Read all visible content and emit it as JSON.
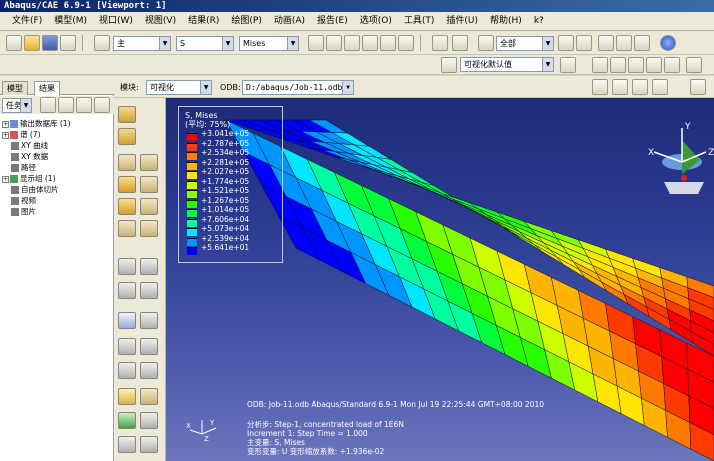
{
  "window": {
    "title": "Abaqus/CAE 6.9-1 [Viewport: 1]"
  },
  "menu": [
    "文件(F)",
    "模型(M)",
    "视口(W)",
    "视图(V)",
    "结果(R)",
    "绘图(P)",
    "动画(A)",
    "报告(E)",
    "选项(O)",
    "工具(T)",
    "插件(U)",
    "帮助(H)",
    "k?"
  ],
  "toolbar1": {
    "combo1": "主",
    "combo2": "S",
    "combo3": "Mises",
    "combo4": "全部"
  },
  "toolbar2": {
    "render_combo": "可视化默认值"
  },
  "toolbar3": {
    "module_label": "模块:",
    "module_value": "可视化",
    "odb_label": "ODB:",
    "odb_value": "D:/abaqus/Job-11.odb"
  },
  "left_panel": {
    "tabs": [
      "模型",
      "结果"
    ],
    "task_label": "任务",
    "tree": [
      {
        "label": "输出数据库 (1)",
        "expand": "+"
      },
      {
        "label": "谱 (7)",
        "expand": "+"
      },
      {
        "label": "XY 曲线",
        "expand": ""
      },
      {
        "label": "XY 数据",
        "expand": ""
      },
      {
        "label": "路径",
        "expand": ""
      },
      {
        "label": "显示组 (1)",
        "expand": "+"
      },
      {
        "label": "自由体切片",
        "expand": ""
      },
      {
        "label": "视频",
        "expand": ""
      },
      {
        "label": "图片",
        "expand": ""
      }
    ]
  },
  "legend": {
    "title": "S, Mises",
    "subtitle": "(平均: 75%)",
    "entries": [
      {
        "value": "+3.041e+05",
        "color": "#ff0000"
      },
      {
        "value": "+2.787e+05",
        "color": "#ff3a00"
      },
      {
        "value": "+2.534e+05",
        "color": "#ff7a00"
      },
      {
        "value": "+2.281e+05",
        "color": "#ffb400"
      },
      {
        "value": "+2.027e+05",
        "color": "#ffe600"
      },
      {
        "value": "+1.774e+05",
        "color": "#cdff00"
      },
      {
        "value": "+1.521e+05",
        "color": "#80ff00"
      },
      {
        "value": "+1.267e+05",
        "color": "#2aff00"
      },
      {
        "value": "+1.014e+05",
        "color": "#00ff3a"
      },
      {
        "value": "+7.606e+04",
        "color": "#00ffa0"
      },
      {
        "value": "+5.073e+04",
        "color": "#00e6ff"
      },
      {
        "value": "+2.539e+04",
        "color": "#0096ff"
      },
      {
        "value": "+5.641e+01",
        "color": "#0000ff"
      }
    ]
  },
  "viewport_info": {
    "line1": "ODB: Job-11.odb    Abaqus/Standard 6.9-1    Mon Jul 19 22:25:44 GMT+08:00 2010",
    "line2": "分析步: Step-1, concentrated load of 1E6N",
    "line3": "Increment    1: Step Time =    1.000",
    "line4": "主变量: S, Mises",
    "line5": "变形变量: U   变形缩放系数: +1.936e-02"
  },
  "triad": {
    "x": "X",
    "y": "Y",
    "z": "Z"
  }
}
